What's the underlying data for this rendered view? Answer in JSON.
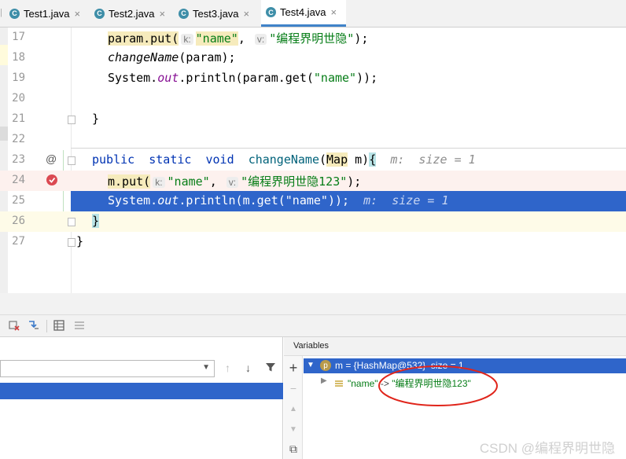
{
  "tabs": [
    {
      "icon": "C",
      "label": "Test1.java",
      "close": "×"
    },
    {
      "icon": "C",
      "label": "Test2.java",
      "close": "×"
    },
    {
      "icon": "C",
      "label": "Test3.java",
      "close": "×"
    },
    {
      "icon": "C",
      "label": "Test4.java",
      "close": "×"
    }
  ],
  "editor": {
    "line_numbers": [
      "17",
      "18",
      "19",
      "20",
      "21",
      "22",
      "23",
      "24",
      "25",
      "26",
      "27"
    ],
    "l17": {
      "a": "param.put(",
      "hint_k": "k:",
      "s1": "\"name\"",
      "comma": ", ",
      "hint_v": "v:",
      "s2": "\"编程界明世隐\"",
      "end": ");"
    },
    "l18": {
      "fn": "changeName",
      "rest": "(param);"
    },
    "l19": {
      "a": "System.",
      "out": "out",
      "b": ".println(param.get(",
      "s": "\"name\"",
      "c": "));"
    },
    "l21": {
      "text": "}"
    },
    "l23": {
      "kw1": "public",
      "kw2": "static",
      "kw3": "void",
      "name": "changeName",
      "lp": "(",
      "type": "Map",
      "param": " m)",
      "brace": "{",
      "inline": "m:  size = 1",
      "marker": "@"
    },
    "l24": {
      "a": "m.put(",
      "hint_k": "k:",
      "s1": "\"name\"",
      "comma": ", ",
      "hint_v": "v:",
      "s2": "\"编程界明世隐123\"",
      "end": ");"
    },
    "l25": {
      "a": "System.",
      "out": "out",
      "b": ".println(m.get(\"name\"));",
      "inline": "m:  size = 1"
    },
    "l26": {
      "text": "}"
    },
    "l27": {
      "text": "}"
    }
  },
  "debug": {
    "variables_title": "Variables",
    "var_m": {
      "icon": "p",
      "text": "m = {HashMap@532}  size = 1"
    },
    "var_child": {
      "key": "\"name\"",
      "arrow": " -> ",
      "value": "\"编程界明世隐123\""
    },
    "side_buttons": [
      "+",
      "−",
      "▲",
      "▼",
      "⧉"
    ]
  },
  "watermark": "CSDN @编程界明世隐",
  "colors": {
    "selection": "#2f65ca",
    "exec_line": "#fdf1ee",
    "accent": "#4083c9"
  }
}
